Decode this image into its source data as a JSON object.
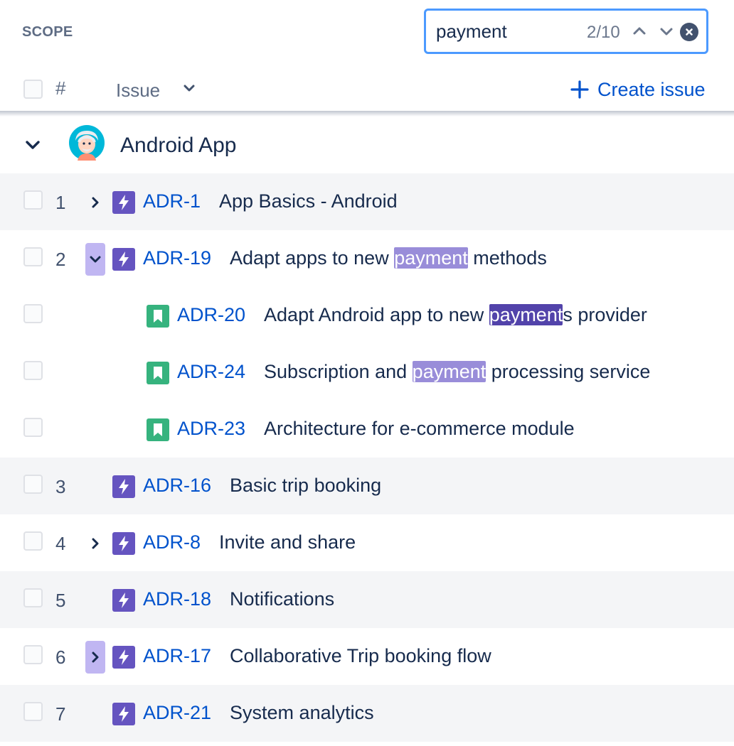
{
  "toolbar": {
    "scope_label": "SCOPE",
    "search": {
      "value": "payment",
      "placeholder": "",
      "match_count": "2/10"
    },
    "icons": [
      "chevron-up-icon",
      "chevron-down-icon",
      "clear-icon"
    ]
  },
  "columns": {
    "hash_label": "#",
    "issue_label": "Issue",
    "create_label": "Create issue"
  },
  "group": {
    "name": "Android App",
    "expanded": true
  },
  "colors": {
    "epic_purple": "#6554c0",
    "story_green": "#36b37e",
    "link_blue": "#0052cc",
    "highlight": "#998dd9",
    "highlight_current": "#5243aa",
    "focus_border": "#4c9aff"
  },
  "rows": [
    {
      "num": "1",
      "toggle": "collapsed",
      "type": "epic",
      "key": "ADR-1",
      "summary": [
        {
          "t": "App Basics - Android"
        }
      ]
    },
    {
      "num": "2",
      "toggle": "expanded",
      "type": "epic",
      "key": "ADR-19",
      "summary": [
        {
          "t": "Adapt apps to new "
        },
        {
          "t": "payment",
          "m": 1
        },
        {
          "t": " methods"
        }
      ]
    },
    {
      "num": "",
      "toggle": "",
      "type": "story",
      "key": "ADR-20",
      "summary": [
        {
          "t": "Adapt Android app to new "
        },
        {
          "t": "payment",
          "m": 2
        },
        {
          "t": "s provider"
        }
      ]
    },
    {
      "num": "",
      "toggle": "",
      "type": "story",
      "key": "ADR-24",
      "summary": [
        {
          "t": "Subscription and "
        },
        {
          "t": "payment",
          "m": 1
        },
        {
          "t": " processing service"
        }
      ]
    },
    {
      "num": "",
      "toggle": "",
      "type": "story",
      "key": "ADR-23",
      "summary": [
        {
          "t": "Architecture for e-commerce module"
        }
      ]
    },
    {
      "num": "3",
      "toggle": "",
      "type": "epic",
      "key": "ADR-16",
      "summary": [
        {
          "t": "Basic trip booking"
        }
      ]
    },
    {
      "num": "4",
      "toggle": "collapsed",
      "type": "epic",
      "key": "ADR-8",
      "summary": [
        {
          "t": "Invite and share"
        }
      ]
    },
    {
      "num": "5",
      "toggle": "",
      "type": "epic",
      "key": "ADR-18",
      "summary": [
        {
          "t": "Notifications"
        }
      ]
    },
    {
      "num": "6",
      "toggle": "collapsed",
      "type": "epic",
      "key": "ADR-17",
      "summary": [
        {
          "t": "Collaborative Trip booking flow"
        }
      ]
    },
    {
      "num": "7",
      "toggle": "",
      "type": "epic",
      "key": "ADR-21",
      "summary": [
        {
          "t": "System analytics"
        }
      ]
    }
  ]
}
